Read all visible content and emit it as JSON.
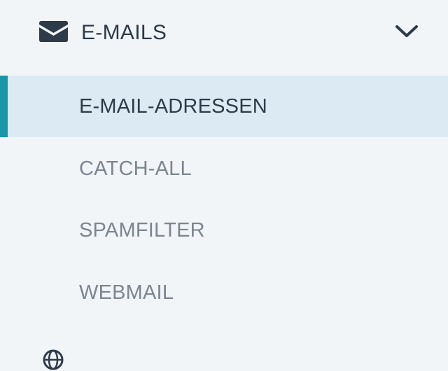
{
  "section": {
    "label": "E-MAILS",
    "icon": "envelope-icon",
    "expanded": true,
    "chevron_icon": "chevron-down-icon"
  },
  "subitems": [
    {
      "label": "E-MAIL-ADRESSEN",
      "active": true
    },
    {
      "label": "CATCH-ALL",
      "active": false
    },
    {
      "label": "SPAMFILTER",
      "active": false
    },
    {
      "label": "WEBMAIL",
      "active": false
    }
  ],
  "next_section": {
    "icon": "globe-icon"
  },
  "colors": {
    "background": "#f2f5f8",
    "active_background": "#dceaf3",
    "accent": "#1797a8",
    "text_dark": "#2e3b48",
    "text_muted": "#7c8590"
  }
}
